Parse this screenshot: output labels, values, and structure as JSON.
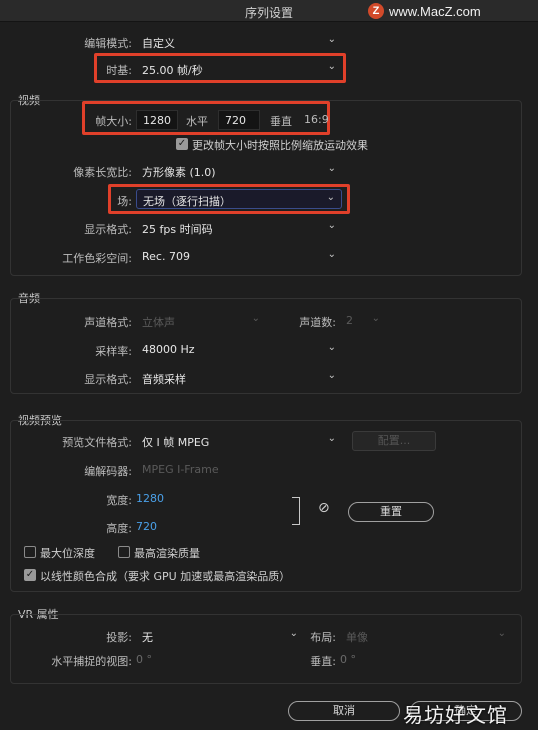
{
  "window": {
    "title": "序列设置",
    "watermark": "www.MacZ.com",
    "watermark_badge": "Z"
  },
  "general": {
    "edit_mode_label": "编辑模式:",
    "edit_mode_value": "自定义",
    "timebase_label": "时基:",
    "timebase_value": "25.00 帧/秒"
  },
  "video": {
    "section": "视频",
    "frame_size_label": "帧大小:",
    "width_value": "1280",
    "horizontal_label": "水平",
    "height_value": "720",
    "vertical_label": "垂直",
    "aspect": "16:9",
    "scale_checkbox_label": "更改帧大小时按照比例缩放运动效果",
    "pixel_aspect_label": "像素长宽比:",
    "pixel_aspect_value": "方形像素 (1.0)",
    "field_label": "场:",
    "field_value": "无场（逐行扫描）",
    "display_format_label": "显示格式:",
    "display_format_value": "25 fps 时间码",
    "color_space_label": "工作色彩空间:",
    "color_space_value": "Rec. 709"
  },
  "audio": {
    "section": "音频",
    "channel_format_label": "声道格式:",
    "channel_format_value": "立体声",
    "channels_label": "声道数:",
    "channels_value": "2",
    "sample_rate_label": "采样率:",
    "sample_rate_value": "48000 Hz",
    "display_format_label": "显示格式:",
    "display_format_value": "音频采样"
  },
  "preview": {
    "section": "视频预览",
    "file_format_label": "预览文件格式:",
    "file_format_value": "仅 I 帧 MPEG",
    "configure_button": "配置...",
    "codec_label": "编解码器:",
    "codec_value": "MPEG I-Frame",
    "width_label": "宽度:",
    "width_value": "1280",
    "height_label": "高度:",
    "height_value": "720",
    "reset_button": "重置",
    "max_depth_label": "最大位深度",
    "max_quality_label": "最高渲染质量",
    "linear_color_label": "以线性颜色合成（要求 GPU 加速或最高渲染品质）"
  },
  "vr": {
    "section": "VR 属性",
    "projection_label": "投影:",
    "projection_value": "无",
    "layout_label": "布局:",
    "layout_value": "单像",
    "h_fov_label": "水平捕捉的视图:",
    "h_fov_value": "0 °",
    "v_fov_label": "垂直:",
    "v_fov_value": "0 °"
  },
  "buttons": {
    "cancel": "取消",
    "ok": "确定"
  },
  "footer_watermark": "易坊好文馆"
}
